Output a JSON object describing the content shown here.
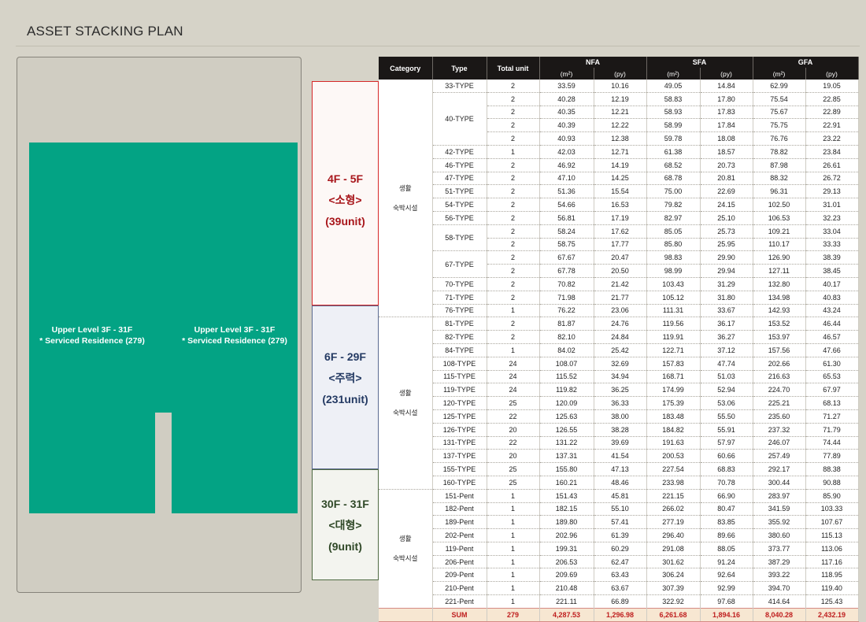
{
  "page": {
    "title": "ASSET STACKING PLAN"
  },
  "stacking": {
    "left_label": [
      "Upper Level 3F - 31F",
      "* Serviced Residence (279)"
    ],
    "right_label": [
      "Upper Level 3F - 31F",
      "* Serviced Residence (279)"
    ]
  },
  "table": {
    "headers": {
      "category": "Category",
      "type": "Type",
      "total_unit": "Total unit",
      "nfa": "NFA",
      "sfa": "SFA",
      "gfa": "GFA",
      "m2": "(m²)",
      "py": "(py)"
    },
    "groups": [
      {
        "floor": "4F - 5F",
        "kind": "<소형>",
        "units": "(39unit)",
        "category": [
          "생활",
          "숙박시설"
        ],
        "rows": [
          [
            "33-TYPE",
            "2",
            "33.59",
            "10.16",
            "49.05",
            "14.84",
            "62.99",
            "19.05"
          ],
          [
            "40-TYPE",
            "2",
            "40.28",
            "12.19",
            "58.83",
            "17.80",
            "75.54",
            "22.85"
          ],
          [
            "",
            "2",
            "40.35",
            "12.21",
            "58.93",
            "17.83",
            "75.67",
            "22.89"
          ],
          [
            "",
            "2",
            "40.39",
            "12.22",
            "58.99",
            "17.84",
            "75.75",
            "22.91"
          ],
          [
            "",
            "2",
            "40.93",
            "12.38",
            "59.78",
            "18.08",
            "76.76",
            "23.22"
          ],
          [
            "42-TYPE",
            "1",
            "42.03",
            "12.71",
            "61.38",
            "18.57",
            "78.82",
            "23.84"
          ],
          [
            "46-TYPE",
            "2",
            "46.92",
            "14.19",
            "68.52",
            "20.73",
            "87.98",
            "26.61"
          ],
          [
            "47-TYPE",
            "2",
            "47.10",
            "14.25",
            "68.78",
            "20.81",
            "88.32",
            "26.72"
          ],
          [
            "51-TYPE",
            "2",
            "51.36",
            "15.54",
            "75.00",
            "22.69",
            "96.31",
            "29.13"
          ],
          [
            "54-TYPE",
            "2",
            "54.66",
            "16.53",
            "79.82",
            "24.15",
            "102.50",
            "31.01"
          ],
          [
            "56-TYPE",
            "2",
            "56.81",
            "17.19",
            "82.97",
            "25.10",
            "106.53",
            "32.23"
          ],
          [
            "58-TYPE",
            "2",
            "58.24",
            "17.62",
            "85.05",
            "25.73",
            "109.21",
            "33.04"
          ],
          [
            "",
            "2",
            "58.75",
            "17.77",
            "85.80",
            "25.95",
            "110.17",
            "33.33"
          ],
          [
            "67-TYPE",
            "2",
            "67.67",
            "20.47",
            "98.83",
            "29.90",
            "126.90",
            "38.39"
          ],
          [
            "",
            "2",
            "67.78",
            "20.50",
            "98.99",
            "29.94",
            "127.11",
            "38.45"
          ],
          [
            "70-TYPE",
            "2",
            "70.82",
            "21.42",
            "103.43",
            "31.29",
            "132.80",
            "40.17"
          ],
          [
            "71-TYPE",
            "2",
            "71.98",
            "21.77",
            "105.12",
            "31.80",
            "134.98",
            "40.83"
          ],
          [
            "76-TYPE",
            "1",
            "76.22",
            "23.06",
            "111.31",
            "33.67",
            "142.93",
            "43.24"
          ]
        ]
      },
      {
        "floor": "6F - 29F",
        "kind": "<주력>",
        "units": "(231unit)",
        "category": [
          "생활",
          "숙박시설"
        ],
        "rows": [
          [
            "81-TYPE",
            "2",
            "81.87",
            "24.76",
            "119.56",
            "36.17",
            "153.52",
            "46.44"
          ],
          [
            "82-TYPE",
            "2",
            "82.10",
            "24.84",
            "119.91",
            "36.27",
            "153.97",
            "46.57"
          ],
          [
            "84-TYPE",
            "1",
            "84.02",
            "25.42",
            "122.71",
            "37.12",
            "157.56",
            "47.66"
          ],
          [
            "108-TYPE",
            "24",
            "108.07",
            "32.69",
            "157.83",
            "47.74",
            "202.66",
            "61.30"
          ],
          [
            "115-TYPE",
            "24",
            "115.52",
            "34.94",
            "168.71",
            "51.03",
            "216.63",
            "65.53"
          ],
          [
            "119-TYPE",
            "24",
            "119.82",
            "36.25",
            "174.99",
            "52.94",
            "224.70",
            "67.97"
          ],
          [
            "120-TYPE",
            "25",
            "120.09",
            "36.33",
            "175.39",
            "53.06",
            "225.21",
            "68.13"
          ],
          [
            "125-TYPE",
            "22",
            "125.63",
            "38.00",
            "183.48",
            "55.50",
            "235.60",
            "71.27"
          ],
          [
            "126-TYPE",
            "20",
            "126.55",
            "38.28",
            "184.82",
            "55.91",
            "237.32",
            "71.79"
          ],
          [
            "131-TYPE",
            "22",
            "131.22",
            "39.69",
            "191.63",
            "57.97",
            "246.07",
            "74.44"
          ],
          [
            "137-TYPE",
            "20",
            "137.31",
            "41.54",
            "200.53",
            "60.66",
            "257.49",
            "77.89"
          ],
          [
            "155-TYPE",
            "25",
            "155.80",
            "47.13",
            "227.54",
            "68.83",
            "292.17",
            "88.38"
          ],
          [
            "160-TYPE",
            "25",
            "160.21",
            "48.46",
            "233.98",
            "70.78",
            "300.44",
            "90.88"
          ]
        ]
      },
      {
        "floor": "30F - 31F",
        "kind": "<대형>",
        "units": "(9unit)",
        "category": [
          "생활",
          "숙박시설"
        ],
        "rows": [
          [
            "151-Pent",
            "1",
            "151.43",
            "45.81",
            "221.15",
            "66.90",
            "283.97",
            "85.90"
          ],
          [
            "182-Pent",
            "1",
            "182.15",
            "55.10",
            "266.02",
            "80.47",
            "341.59",
            "103.33"
          ],
          [
            "189-Pent",
            "1",
            "189.80",
            "57.41",
            "277.19",
            "83.85",
            "355.92",
            "107.67"
          ],
          [
            "202-Pent",
            "1",
            "202.96",
            "61.39",
            "296.40",
            "89.66",
            "380.60",
            "115.13"
          ],
          [
            "119-Pent",
            "1",
            "199.31",
            "60.29",
            "291.08",
            "88.05",
            "373.77",
            "113.06"
          ],
          [
            "206-Pent",
            "1",
            "206.53",
            "62.47",
            "301.62",
            "91.24",
            "387.29",
            "117.16"
          ],
          [
            "209-Pent",
            "1",
            "209.69",
            "63.43",
            "306.24",
            "92.64",
            "393.22",
            "118.95"
          ],
          [
            "210-Pent",
            "1",
            "210.48",
            "63.67",
            "307.39",
            "92.99",
            "394.70",
            "119.40"
          ],
          [
            "221-Pent",
            "1",
            "221.11",
            "66.89",
            "322.92",
            "97.68",
            "414.64",
            "125.43"
          ]
        ]
      }
    ],
    "sum": [
      "SUM",
      "279",
      "4,287.53",
      "1,296.98",
      "6,261.68",
      "1,894.16",
      "8,040.28",
      "2,432.19"
    ]
  },
  "colors": {
    "tower": "#03a384",
    "group1": "#a8161b",
    "group2": "#243a63",
    "group3": "#2f4827",
    "sum": "#bf1e1e"
  }
}
